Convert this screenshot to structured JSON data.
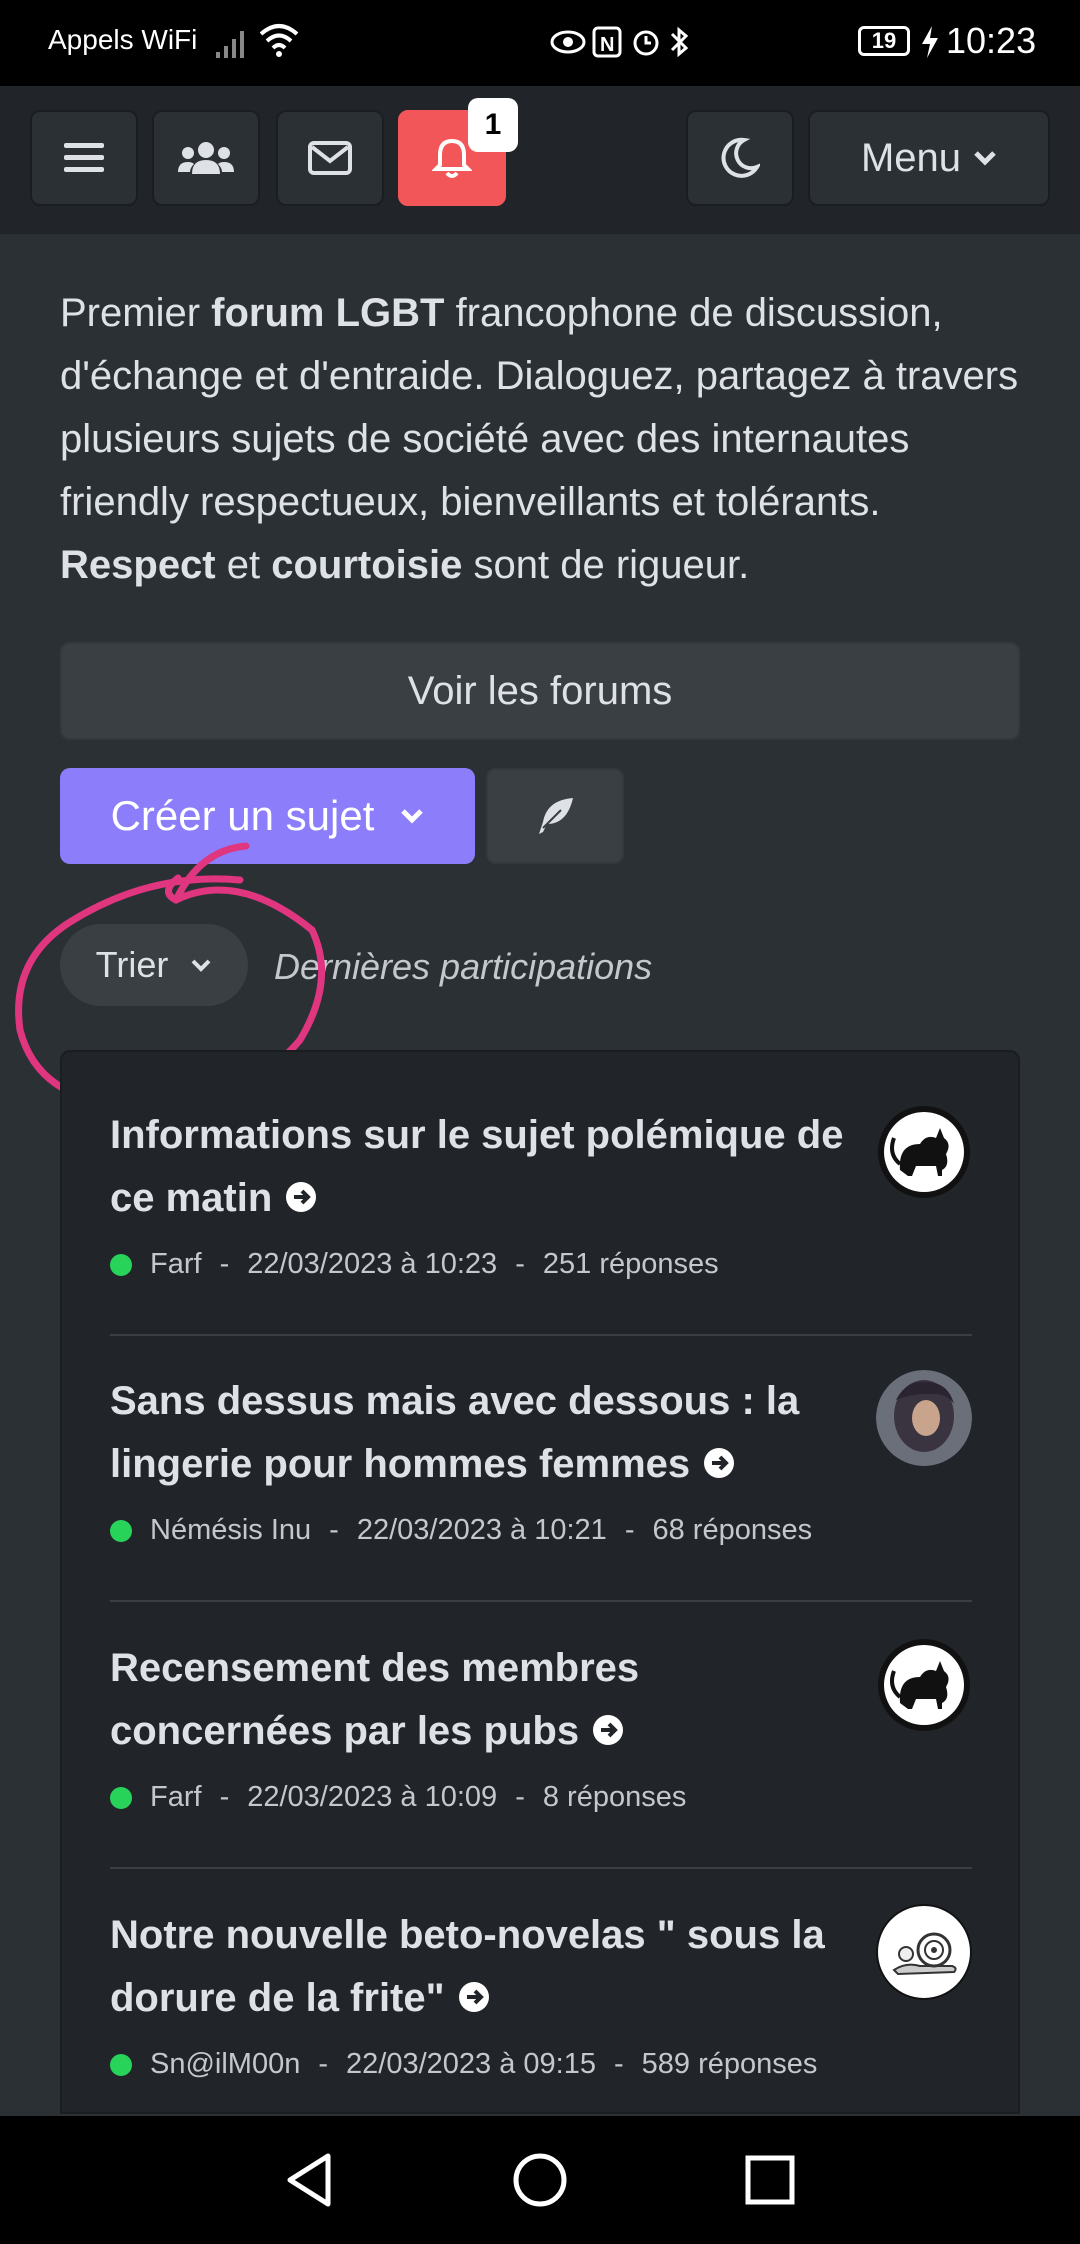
{
  "status_bar": {
    "carrier": "Appels WiFi",
    "battery": "19",
    "time": "10:23"
  },
  "navbar": {
    "notification_count": "1",
    "menu_label": "Menu"
  },
  "intro": {
    "part1": "Premier ",
    "bold1": "forum LGBT",
    "part2": " francophone de discussion, d'échange et d'entraide. Dialoguez, partagez à travers plusieurs sujets de société avec des internautes friendly respectueux, bienveillants et tolérants. ",
    "bold2": "Respect",
    "part3": " et ",
    "bold3": "courtoisie",
    "part4": " sont de rigueur."
  },
  "actions": {
    "view_forums": "Voir les forums",
    "create_topic": "Créer un sujet",
    "sort_button": "Trier",
    "sort_label": "Dernières participations"
  },
  "topics": [
    {
      "title": "Informations sur le sujet polémique de ce matin",
      "author": "Farf",
      "date": "22/03/2023 à 10:23",
      "replies": "251 réponses"
    },
    {
      "title": "Sans dessus mais avec dessous : la lingerie pour hommes femmes",
      "author": "Némésis Inu",
      "date": "22/03/2023 à 10:21",
      "replies": "68 réponses"
    },
    {
      "title": "Recensement des membres concernées par les pubs",
      "author": "Farf",
      "date": "22/03/2023 à 10:09",
      "replies": "8 réponses"
    },
    {
      "title": "Notre nouvelle beto-novelas \" sous la dorure de la frite\"",
      "author": "Sn@ilM00n",
      "date": "22/03/2023 à 09:15",
      "replies": "589 réponses"
    }
  ],
  "colors": {
    "background": "#2b3035",
    "navbar": "#212529",
    "notification": "#f25658",
    "primary": "#8c7dfa",
    "online": "#28d35a",
    "annotation": "#e0357f"
  }
}
